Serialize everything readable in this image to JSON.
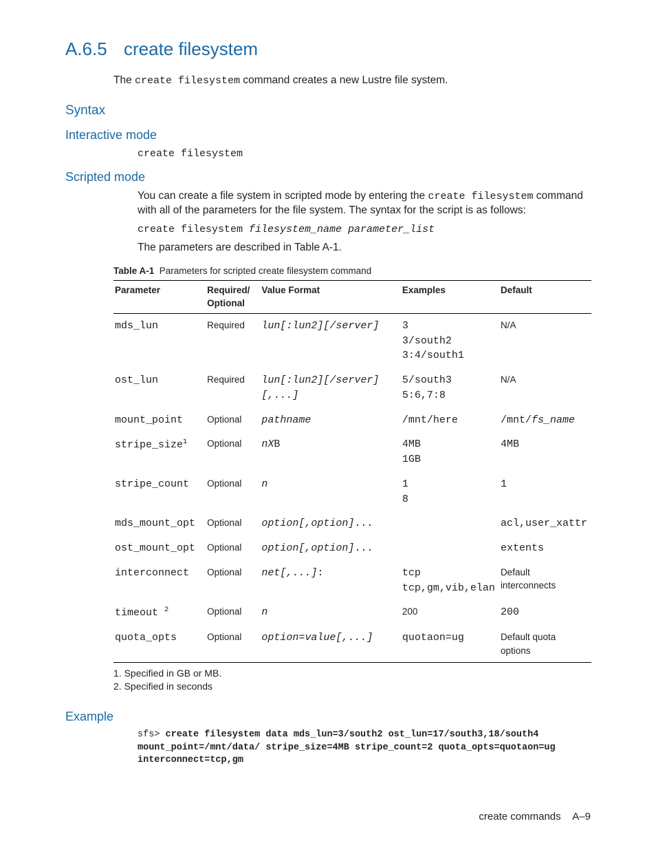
{
  "section": {
    "number": "A.6.5",
    "title": "create filesystem"
  },
  "intro": {
    "pre": "The ",
    "code": "create filesystem",
    "post": " command creates a new Lustre file system."
  },
  "syntax": {
    "heading": "Syntax",
    "interactive": {
      "heading": "Interactive mode",
      "code": "create filesystem"
    },
    "scripted": {
      "heading": "Scripted mode",
      "desc_pre": "You can create a file system in scripted mode by entering the ",
      "desc_code": "create filesystem",
      "desc_post": " command with all of the parameters for the file system. The syntax for the script is as follows:",
      "code_plain": "create filesystem ",
      "code_italic": "filesystem_name parameter_list",
      "post": "The parameters are described in Table A-1."
    }
  },
  "table": {
    "caption_label": "Table A-1",
    "caption_text": "Parameters for scripted create filesystem command",
    "head": {
      "c1": "Parameter",
      "c2": "Required/ Optional",
      "c3": "Value Format",
      "c4": "Examples",
      "c5": "Default"
    },
    "rows": [
      {
        "param": "mds_lun",
        "sup": "",
        "req": "Required",
        "fmt_i": "lun[:lun2][/server]",
        "fmt_p": "",
        "ex": "3\n3/south2\n3:4/south1",
        "def": "N/A",
        "def_mono": false
      },
      {
        "param": "ost_lun",
        "sup": "",
        "req": "Required",
        "fmt_i": "lun[:lun2][/server][,...]",
        "fmt_p": "",
        "ex": "5/south3\n5:6,7:8",
        "def": "N/A",
        "def_mono": false
      },
      {
        "param": "mount_point",
        "sup": "",
        "req": "Optional",
        "fmt_i": "pathname",
        "fmt_p": "",
        "ex": "/mnt/here",
        "def": "/mnt/fs_name",
        "def_mono": true,
        "def_italic_part": "fs_name"
      },
      {
        "param": "stripe_size",
        "sup": "1",
        "req": "Optional",
        "fmt_i": "nX",
        "fmt_p": "B",
        "ex": "4MB\n1GB",
        "def": "4MB",
        "def_mono": true
      },
      {
        "param": "stripe_count",
        "sup": "",
        "req": "Optional",
        "fmt_i": "n",
        "fmt_p": "",
        "ex": "1\n8",
        "def": "1",
        "def_mono": true
      },
      {
        "param": "mds_mount_opt",
        "sup": "",
        "req": "Optional",
        "fmt_i": "option[,option]",
        "fmt_p": "...",
        "ex": "",
        "def": "acl,user_xattr",
        "def_mono": true
      },
      {
        "param": "ost_mount_opt",
        "sup": "",
        "req": "Optional",
        "fmt_i": "option[,option]",
        "fmt_p": "...",
        "ex": "",
        "def": "extents",
        "def_mono": true
      },
      {
        "param": "interconnect",
        "sup": "",
        "req": "Optional",
        "fmt_i": "net[,...]",
        "fmt_p": ":",
        "ex": "tcp\ntcp,gm,vib,elan",
        "def": "Default interconnects",
        "def_mono": false
      },
      {
        "param": "timeout ",
        "sup": "2",
        "req": "Optional",
        "fmt_i": "n",
        "fmt_p": "",
        "ex_plain": "200",
        "ex": "",
        "def": "200",
        "def_mono": true
      },
      {
        "param": "quota_opts",
        "sup": "",
        "req": "Optional",
        "fmt_i": "option=value[,...]",
        "fmt_p": "",
        "ex": "quotaon=ug",
        "def": "Default quota options",
        "def_mono": false
      }
    ]
  },
  "footnotes": {
    "f1": "1. Specified in GB or MB.",
    "f2": "2. Specified in seconds"
  },
  "example": {
    "heading": "Example",
    "prompt": "sfs> ",
    "cmd": "create filesystem data mds_lun=3/south2 ost_lun=17/south3,18/south4 mount_point=/mnt/data/ stripe_size=4MB stripe_count=2 quota_opts=quotaon=ug interconnect=tcp,gm"
  },
  "footer": {
    "text": "create commands",
    "page": "A–9"
  }
}
